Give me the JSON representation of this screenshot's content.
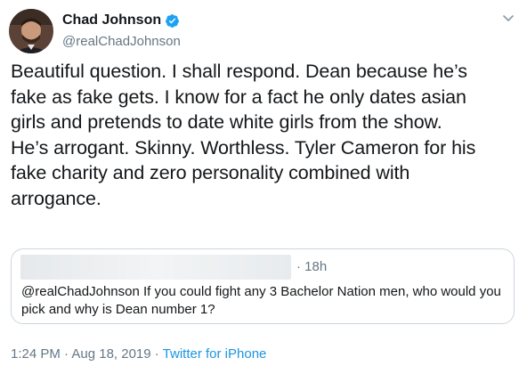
{
  "tweet": {
    "display_name": "Chad Johnson",
    "handle": "@realChadJohnson",
    "verified_icon": "verified-badge-icon",
    "avatar_icon": "avatar",
    "more_icon": "chevron-down-icon",
    "text": "Beautiful question. I shall respond. Dean because he’s\nfake as fake gets. I know for a fact he only dates asian\ngirls and pretends to date white girls from the show.\nHe’s arrogant. Skinny. Worthless. Tyler Cameron for his\nfake charity and zero personality combined with\narrogance.",
    "timestamp": "1:24 PM · Aug 18, 2019 · ",
    "source": "Twitter for iPhone"
  },
  "quoted_tweet": {
    "time": "· 18h",
    "text": "@realChadJohnson If you could fight any 3 Bachelor Nation men, who would you pick and why is Dean number 1?"
  },
  "colors": {
    "text": "#14171a",
    "secondary": "#657786",
    "accent": "#1b95e0",
    "verified": "#1da1f2",
    "border": "#ccd6dd"
  }
}
